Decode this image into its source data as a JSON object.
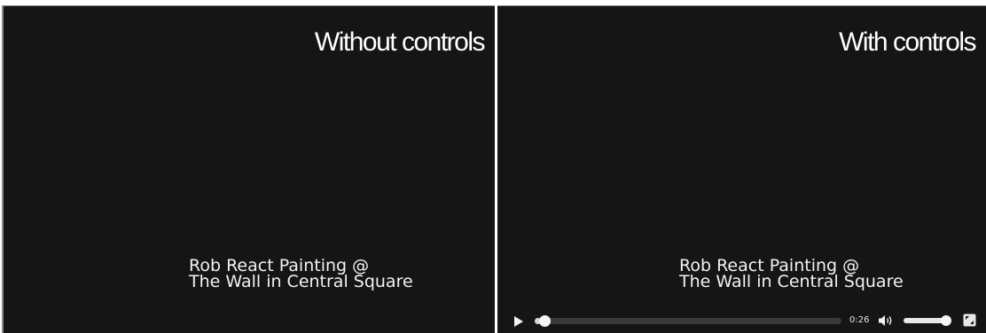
{
  "left_panel": {
    "heading": "Without controls",
    "caption_line1": "Rob React Painting @",
    "caption_line2": "The Wall in Central Square"
  },
  "right_panel": {
    "heading": "With controls",
    "caption_line1": "Rob React Painting @",
    "caption_line2": "The Wall in Central Square",
    "controls": {
      "play_icon": "play-icon",
      "progress_fraction": 0.02,
      "time": "0:26",
      "volume_icon": "speaker-icon",
      "volume_fraction": 0.92,
      "fullscreen_icon": "fullscreen-icon"
    }
  },
  "colors": {
    "video_background": "#151515",
    "page_background": "#ffffff",
    "text": "#ffffff"
  }
}
